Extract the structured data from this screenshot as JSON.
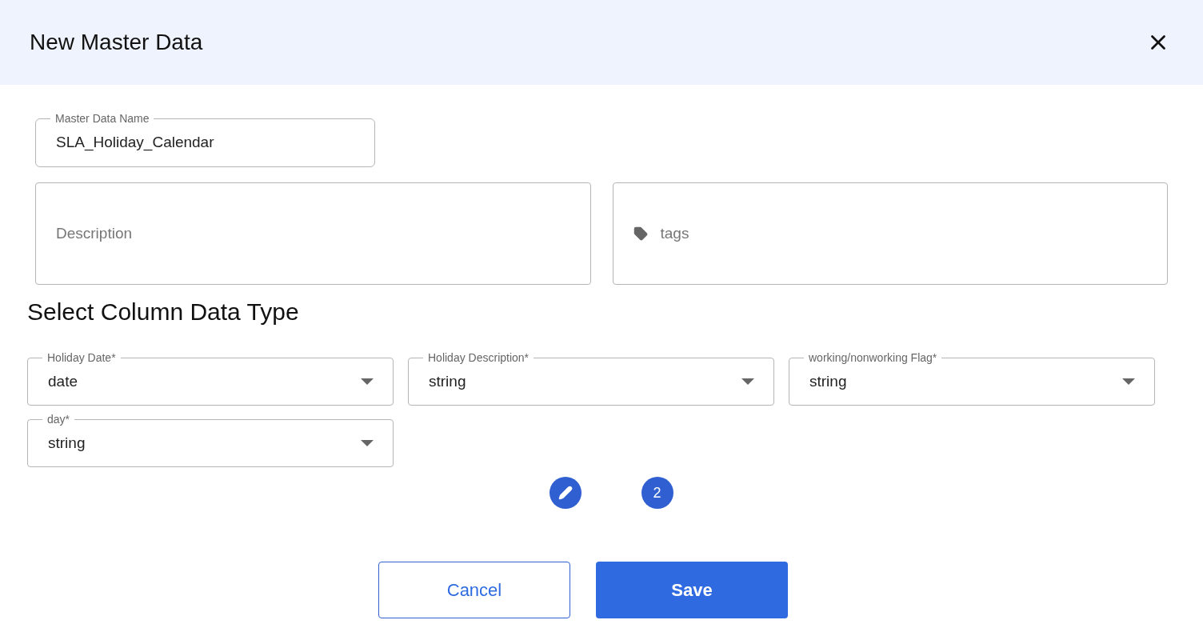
{
  "dialog": {
    "title": "New Master Data"
  },
  "name_field": {
    "label": "Master Data Name",
    "value": "SLA_Holiday_Calendar"
  },
  "description_field": {
    "placeholder": "Description"
  },
  "tags_field": {
    "placeholder": "tags"
  },
  "section_title": "Select Column Data Type",
  "columns": [
    {
      "label": "Holiday Date*",
      "value": "date"
    },
    {
      "label": "Holiday Description*",
      "value": "string"
    },
    {
      "label": "working/nonworking Flag*",
      "value": "string"
    },
    {
      "label": "day*",
      "value": "string"
    }
  ],
  "count_badge": "2",
  "buttons": {
    "cancel": "Cancel",
    "save": "Save"
  }
}
